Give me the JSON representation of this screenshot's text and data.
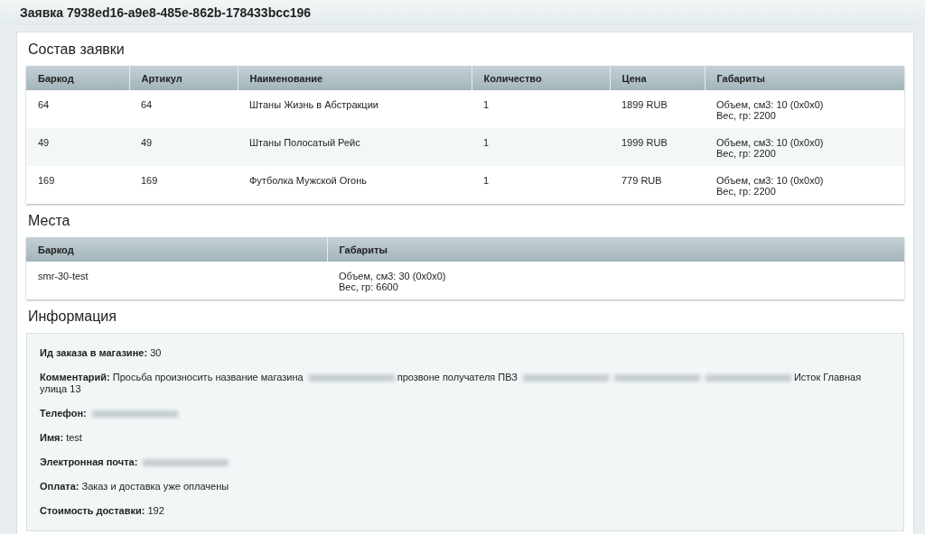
{
  "title": "Заявка 7938ed16-a9e8-485e-862b-178433bcc196",
  "composition": {
    "heading": "Состав заявки",
    "columns": [
      "Баркод",
      "Артикул",
      "Наименование",
      "Количество",
      "Цена",
      "Габариты"
    ],
    "rows": [
      [
        "64",
        "64",
        "Штаны Жизнь в Абстракции",
        "1",
        "1899 RUB",
        [
          "Объем, см3: 10 (0x0x0)",
          "Вес, гр: 2200"
        ]
      ],
      [
        "49",
        "49",
        "Штаны Полосатый Рейс",
        "1",
        "1999 RUB",
        [
          "Объем, см3: 10 (0x0x0)",
          "Вес, гр: 2200"
        ]
      ],
      [
        "169",
        "169",
        "Футболка Мужской Огонь",
        "1",
        "779 RUB",
        [
          "Объем, см3: 10 (0x0x0)",
          "Вес, гр: 2200"
        ]
      ]
    ]
  },
  "places": {
    "heading": "Места",
    "columns": [
      "Баркод",
      "Габариты"
    ],
    "rows": [
      [
        "smr-30-test",
        [
          "Объем, см3: 30 (0x0x0)",
          "Вес, гр: 6600"
        ]
      ]
    ]
  },
  "info": {
    "heading": "Информация",
    "fields": [
      {
        "label": "Ид заказа в магазине:",
        "value": [
          {
            "kind": "text",
            "text": "30"
          }
        ]
      },
      {
        "label": "Комментарий:",
        "value": [
          {
            "kind": "text",
            "text": "Просьба произносить название магазина"
          },
          {
            "kind": "redacted"
          },
          {
            "kind": "text",
            "text": "прозвоне получателя ПВЗ"
          },
          {
            "kind": "redacted"
          },
          {
            "kind": "redacted"
          },
          {
            "kind": "redacted"
          },
          {
            "kind": "text",
            "text": "Исток Главная"
          },
          {
            "kind": "text",
            "text": "улица 13"
          }
        ]
      },
      {
        "label": "Телефон:",
        "value": [
          {
            "kind": "redacted"
          }
        ]
      },
      {
        "label": "Имя:",
        "value": [
          {
            "kind": "text",
            "text": "test"
          }
        ]
      },
      {
        "label": "Электронная почта:",
        "value": [
          {
            "kind": "redacted"
          }
        ]
      },
      {
        "label": "Оплата:",
        "value": [
          {
            "kind": "text",
            "text": "Заказ и доставка уже оплачены"
          }
        ]
      },
      {
        "label": "Стоимость доставки:",
        "value": [
          {
            "kind": "text",
            "text": "192"
          }
        ]
      }
    ]
  }
}
